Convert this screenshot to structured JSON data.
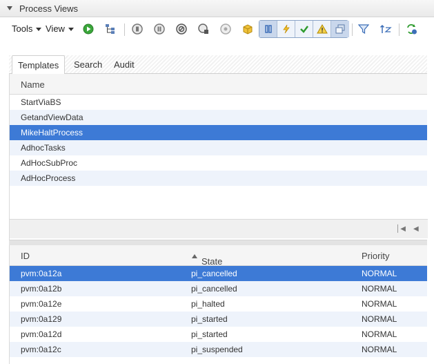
{
  "header": {
    "title": "Process Views"
  },
  "toolbar": {
    "tools_label": "Tools",
    "view_label": "View",
    "icons": [
      "start-icon",
      "process-tree-icon",
      "pause-icon",
      "suspend-icon",
      "cancel-icon",
      "resume-icon",
      "disabled-icon",
      "package-icon",
      "running-filter-icon",
      "lightning-filter-icon",
      "success-filter-icon",
      "warning-filter-icon",
      "windows-filter-icon",
      "filter-icon",
      "sort-icon",
      "refresh-icon"
    ]
  },
  "tabs": [
    {
      "label": "Templates",
      "active": true
    },
    {
      "label": "Search",
      "active": false
    },
    {
      "label": "Audit",
      "active": false
    }
  ],
  "templates": {
    "column": "Name",
    "rows": [
      "StartViaBS",
      "GetandViewData",
      "MikeHaltProcess",
      "AdhocTasks",
      "AdHocSubProc",
      "AdHocProcess"
    ],
    "selected_index": 2
  },
  "instances": {
    "columns": {
      "id": "ID",
      "state": "State",
      "priority": "Priority"
    },
    "rows": [
      {
        "id": "pvm:0a12a",
        "state": "pi_cancelled",
        "priority": "NORMAL"
      },
      {
        "id": "pvm:0a12b",
        "state": "pi_cancelled",
        "priority": "NORMAL"
      },
      {
        "id": "pvm:0a12e",
        "state": "pi_halted",
        "priority": "NORMAL"
      },
      {
        "id": "pvm:0a129",
        "state": "pi_started",
        "priority": "NORMAL"
      },
      {
        "id": "pvm:0a12d",
        "state": "pi_started",
        "priority": "NORMAL"
      },
      {
        "id": "pvm:0a12c",
        "state": "pi_suspended",
        "priority": "NORMAL"
      }
    ],
    "selected_index": 0
  },
  "colors": {
    "selection": "#3d7ad6",
    "alt_row": "#eef3fb",
    "accent_green": "#3aa63a"
  }
}
